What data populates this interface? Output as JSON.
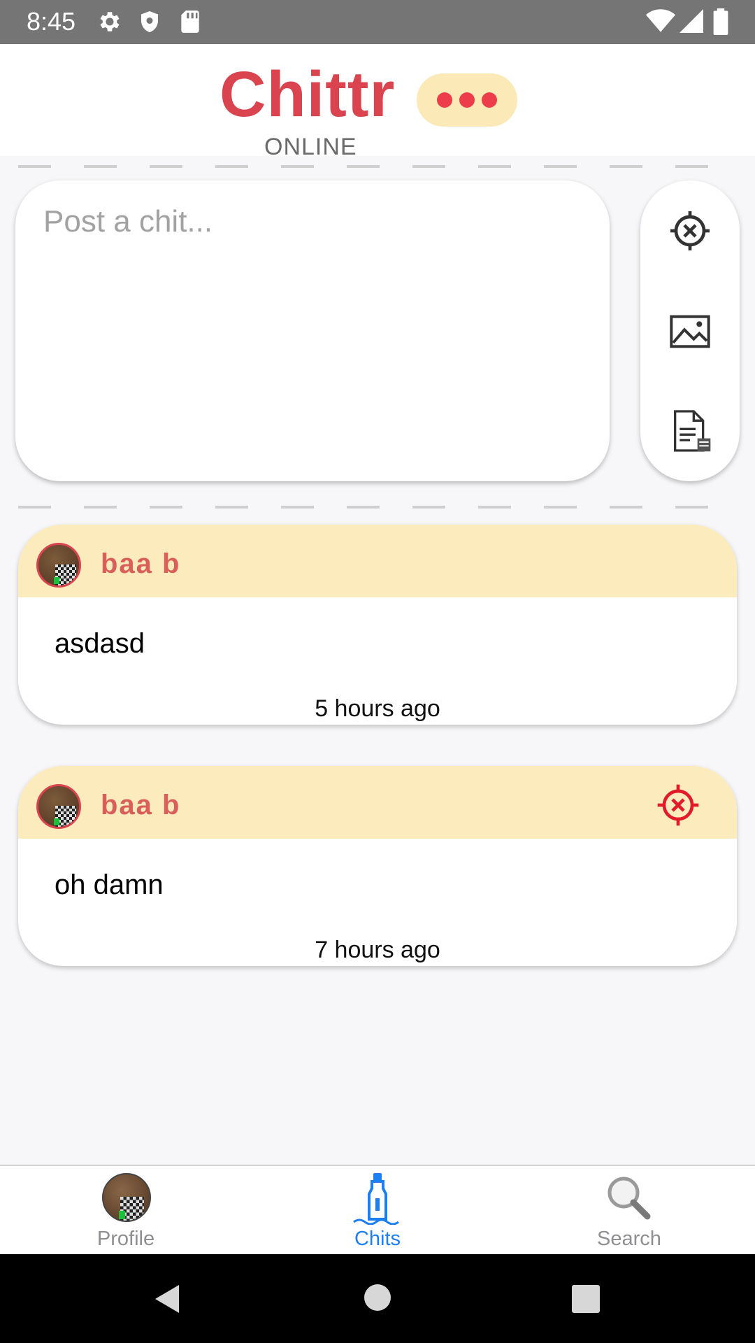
{
  "status_bar": {
    "time": "8:45",
    "left_icons": [
      "gear-icon",
      "shield-icon",
      "sd-card-icon"
    ],
    "right_icons": [
      "wifi-icon",
      "signal-icon",
      "battery-icon"
    ]
  },
  "header": {
    "title": "Chittr",
    "status": "ONLINE",
    "menu_icon": "more-dots-icon"
  },
  "composer": {
    "placeholder": "Post a chit...",
    "tools": [
      "location-off-icon",
      "image-icon",
      "drafts-icon"
    ]
  },
  "feed": [
    {
      "author": "baa b",
      "text": "asdasd",
      "time": "5 hours ago",
      "has_location": false
    },
    {
      "author": "baa b",
      "text": "oh damn",
      "time": "7 hours ago",
      "has_location": true
    }
  ],
  "tabs": [
    {
      "label": "Profile",
      "icon": "avatar",
      "active": false
    },
    {
      "label": "Chits",
      "icon": "bottle-icon",
      "active": true
    },
    {
      "label": "Search",
      "icon": "search-icon",
      "active": false
    }
  ],
  "colors": {
    "brand": "#d9444e",
    "accent_bg": "#fbebbd",
    "active_tab": "#1e7ff1"
  }
}
